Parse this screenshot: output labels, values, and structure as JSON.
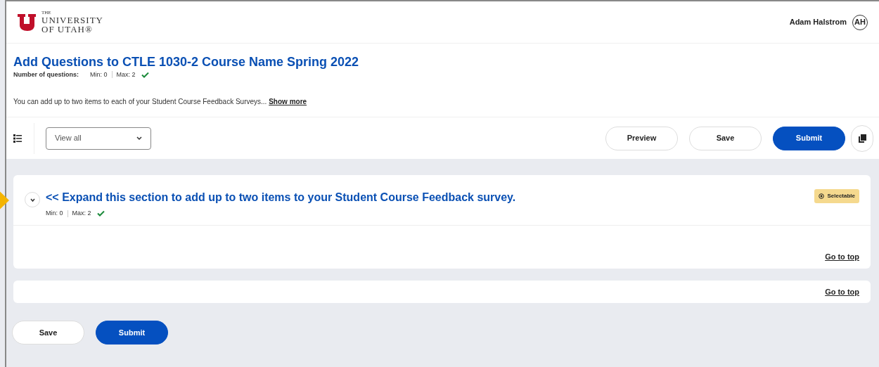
{
  "header": {
    "logo": {
      "line_1": "THE",
      "line_2": "UNIVERSITY",
      "line_3": "OF UTAH®"
    },
    "user": {
      "name": "Adam Halstrom",
      "initials": "AH"
    }
  },
  "page": {
    "title": "Add Questions to CTLE 1030-2 Course Name Spring 2022",
    "count_label": "Number of questions:",
    "min": "Min: 0",
    "max": "Max: 2",
    "valid": true,
    "description": "You can add up to two items to each of your Student Course Feedback Surveys...",
    "show_more": "Show more"
  },
  "toolbar": {
    "filter": {
      "value": "View all"
    },
    "buttons": [
      {
        "label": "Preview",
        "kind": "outline"
      },
      {
        "label": "Save",
        "kind": "outline"
      },
      {
        "label": "Submit",
        "kind": "primary"
      }
    ]
  },
  "sections": [
    {
      "title": "<< Expand this section to add up to two items to your Student Course Feedback survey.",
      "expanded": false,
      "min": "Min: 0",
      "max": "Max: 2",
      "valid": true,
      "badge": "Selectable",
      "go_to_top": "Go to top"
    },
    {
      "go_to_top": "Go to top"
    }
  ],
  "footer_buttons": [
    {
      "label": "Save",
      "kind": "outline"
    },
    {
      "label": "Submit",
      "kind": "primary"
    }
  ]
}
